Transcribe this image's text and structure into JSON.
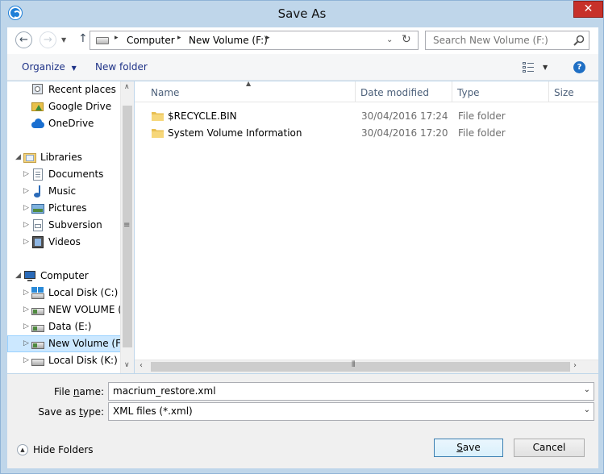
{
  "window": {
    "title": "Save As",
    "close_glyph": "✕"
  },
  "address_bar": {
    "segments": [
      "Computer",
      "New Volume (F:)"
    ],
    "separator": "▸"
  },
  "search": {
    "placeholder": "Search New Volume (F:)"
  },
  "toolbar": {
    "organize_label": "Organize",
    "new_folder_label": "New folder"
  },
  "nav": {
    "items": [
      {
        "label": "Recent places",
        "icon": "recent-places-icon"
      },
      {
        "label": "Google Drive",
        "icon": "google-drive-icon"
      },
      {
        "label": "OneDrive",
        "icon": "onedrive-icon"
      },
      {
        "label": "Libraries",
        "icon": "libraries-icon"
      },
      {
        "label": "Documents",
        "icon": "documents-icon"
      },
      {
        "label": "Music",
        "icon": "music-icon"
      },
      {
        "label": "Pictures",
        "icon": "pictures-icon"
      },
      {
        "label": "Subversion",
        "icon": "subversion-icon"
      },
      {
        "label": "Videos",
        "icon": "videos-icon"
      },
      {
        "label": "Computer",
        "icon": "computer-icon"
      },
      {
        "label": "Local Disk (C:)",
        "icon": "local-disk-icon"
      },
      {
        "label": "NEW VOLUME (D:)",
        "icon": "drive-icon"
      },
      {
        "label": "Data (E:)",
        "icon": "drive-icon"
      },
      {
        "label": "New Volume (F:)",
        "icon": "drive-icon"
      },
      {
        "label": "Local Disk (K:)",
        "icon": "local-disk-icon"
      }
    ]
  },
  "columns": {
    "name": "Name",
    "date_modified": "Date modified",
    "type": "Type",
    "size": "Size"
  },
  "files": [
    {
      "name": "$RECYCLE.BIN",
      "date": "30/04/2016 17:24",
      "type": "File folder"
    },
    {
      "name": "System Volume Information",
      "date": "30/04/2016 17:20",
      "type": "File folder"
    }
  ],
  "form": {
    "file_name_label_prefix": "File ",
    "file_name_label_u": "n",
    "file_name_label_suffix": "ame:",
    "file_name_value": "macrium_restore.xml",
    "save_type_label_prefix": "Save as ",
    "save_type_label_u": "t",
    "save_type_label_suffix": "ype:",
    "save_type_value": "XML files (*.xml)"
  },
  "footer": {
    "hide_folders_label": "Hide Folders",
    "save_label_u": "S",
    "save_label_rest": "ave",
    "cancel_label": "Cancel"
  },
  "colors": {
    "frame": "#bfd6ea",
    "close": "#c7312a",
    "link": "#1e3287",
    "selected": "#cce8ff"
  }
}
